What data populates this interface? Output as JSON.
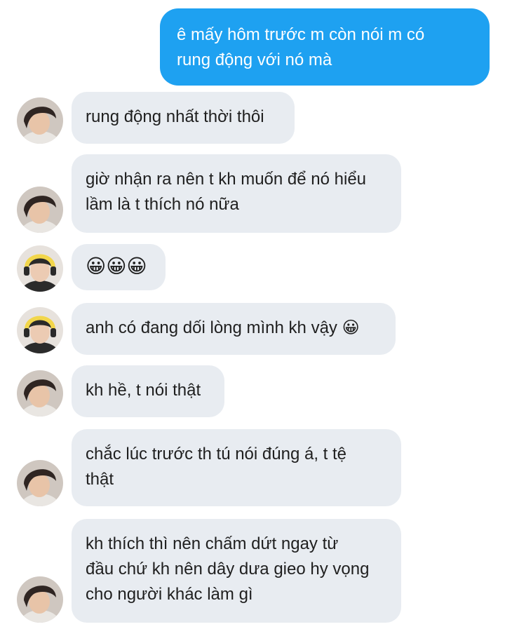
{
  "messages": [
    {
      "side": "outgoing",
      "text": "ê mấy hôm trước m còn nói m có\nrung động với nó mà"
    },
    {
      "side": "incoming",
      "sender": "A",
      "text": "rung động nhất thời thôi"
    },
    {
      "side": "incoming",
      "sender": "A",
      "text": "giờ nhận ra nên t kh muốn để nó hiểu\nlầm là t thích nó nữa"
    },
    {
      "side": "incoming",
      "sender": "B",
      "text": "😀😀😀"
    },
    {
      "side": "incoming",
      "sender": "B",
      "text": "anh có đang dối lòng mình kh vậy 😀"
    },
    {
      "side": "incoming",
      "sender": "A",
      "text": "kh hề, t nói thật"
    },
    {
      "side": "incoming",
      "sender": "A",
      "text": "chắc lúc trước th tú nói đúng á, t tệ\nthật"
    },
    {
      "side": "incoming",
      "sender": "A",
      "text": "kh thích thì nên chấm dứt ngay từ\nđầu chứ kh nên dây dưa gieo hy vọng\ncho người khác làm gì"
    }
  ],
  "colors": {
    "outgoing_bubble": "#1ea1f1",
    "incoming_bubble": "#e8ecf1",
    "background": "#ffffff"
  },
  "icons": {
    "avatar_A": "avatar-dark-hair",
    "avatar_B": "avatar-headset-yellow"
  }
}
